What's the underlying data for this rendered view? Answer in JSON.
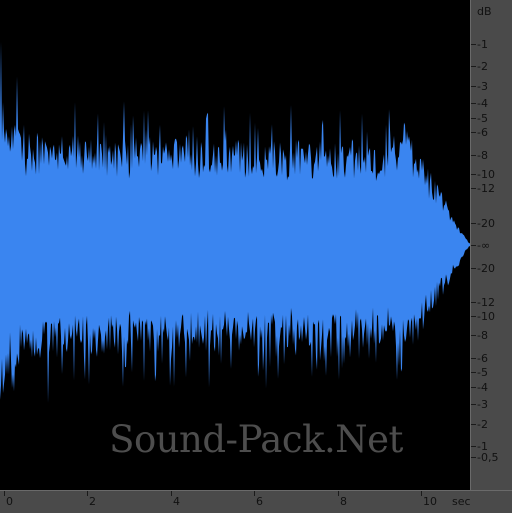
{
  "colors": {
    "waveform": "#3a85f0",
    "background": "#000000",
    "ruler": "#4a4a4a",
    "ruler_text": "#111111"
  },
  "db_ruler": {
    "unit_label": "dB",
    "upper": [
      {
        "label": "1",
        "db": -1
      },
      {
        "label": "2",
        "db": -2
      },
      {
        "label": "3",
        "db": -3
      },
      {
        "label": "4",
        "db": -4
      },
      {
        "label": "5",
        "db": -5
      },
      {
        "label": "6",
        "db": -6
      },
      {
        "label": "8",
        "db": -8
      },
      {
        "label": "10",
        "db": -10
      },
      {
        "label": "12",
        "db": -12
      },
      {
        "label": "20",
        "db": -20
      }
    ],
    "center_label": "-∞",
    "lower": [
      {
        "label": "20",
        "db": -20
      },
      {
        "label": "12",
        "db": -12
      },
      {
        "label": "10",
        "db": -10
      },
      {
        "label": "8",
        "db": -8
      },
      {
        "label": "6",
        "db": -6
      },
      {
        "label": "5",
        "db": -5
      },
      {
        "label": "4",
        "db": -4
      },
      {
        "label": "3",
        "db": -3
      },
      {
        "label": "2",
        "db": -2
      },
      {
        "label": "1",
        "db": -1
      },
      {
        "label": "0,5",
        "db": -0.5
      }
    ]
  },
  "time_ruler": {
    "unit_label": "sec",
    "ticks": [
      {
        "label": "0",
        "sec": 0
      },
      {
        "label": "2",
        "sec": 2
      },
      {
        "label": "4",
        "sec": 4
      },
      {
        "label": "6",
        "sec": 6
      },
      {
        "label": "8",
        "sec": 8
      },
      {
        "label": "10",
        "sec": 10
      }
    ],
    "max_sec": 11.2
  },
  "watermark": "Sound-Pack.Net"
}
